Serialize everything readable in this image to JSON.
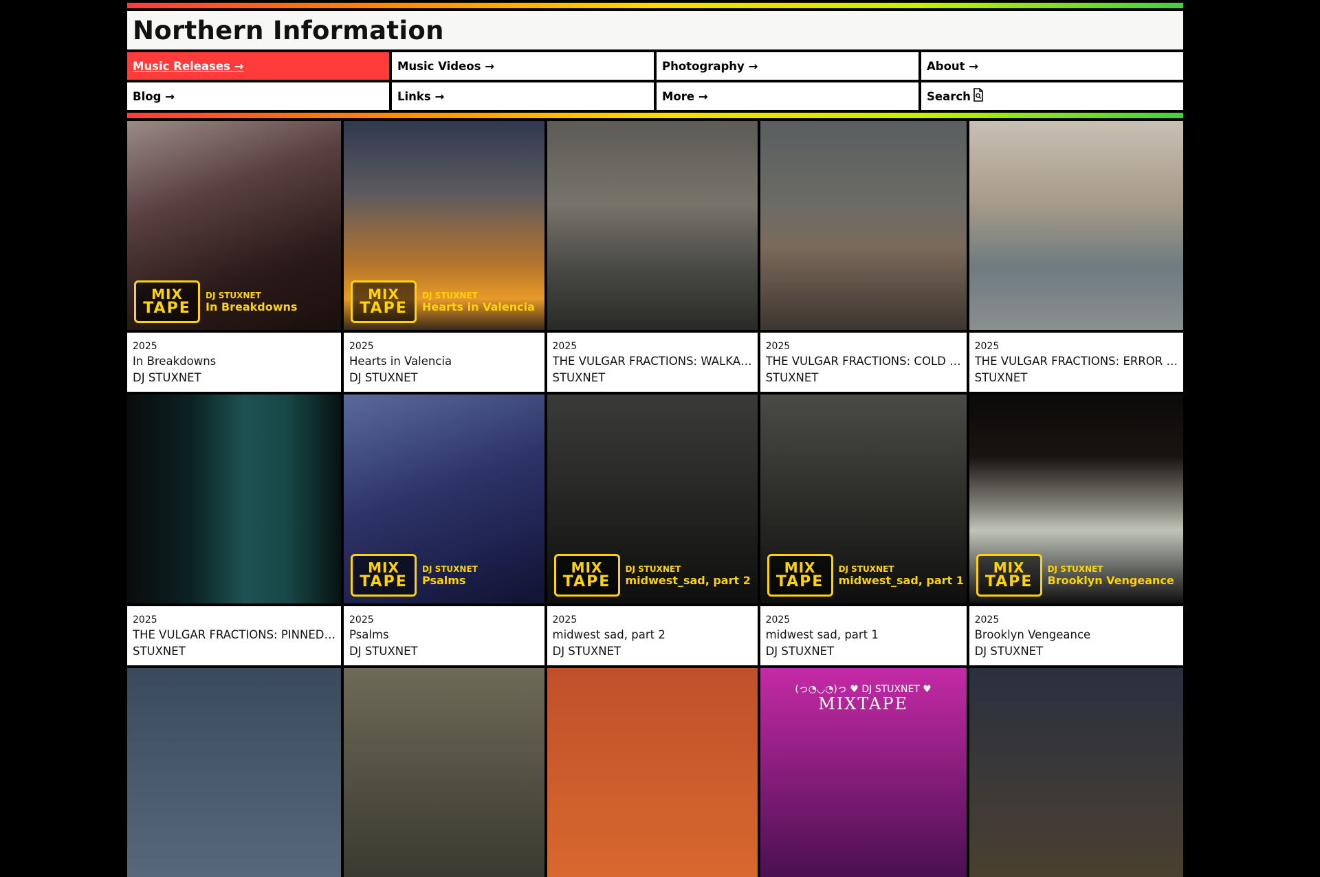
{
  "site": {
    "title": "Northern Information"
  },
  "nav": [
    {
      "label": "Music Releases →",
      "active": true,
      "name": "nav-music-releases"
    },
    {
      "label": "Music Videos →",
      "active": false,
      "name": "nav-music-videos"
    },
    {
      "label": "Photography →",
      "active": false,
      "name": "nav-photography"
    },
    {
      "label": "About →",
      "active": false,
      "name": "nav-about"
    },
    {
      "label": "Blog →",
      "active": false,
      "name": "nav-blog"
    },
    {
      "label": "Links →",
      "active": false,
      "name": "nav-links"
    },
    {
      "label": "More →",
      "active": false,
      "name": "nav-more"
    },
    {
      "label": "Search",
      "active": false,
      "name": "nav-search",
      "icon": "search-document-icon"
    }
  ],
  "badge": {
    "logo_top": "MIX",
    "logo_bottom": "TAPE",
    "dj": "DJ STUXNET"
  },
  "colors": {
    "accent": "#ff3b3b",
    "badge": "#ffd400"
  },
  "releases": [
    {
      "year": "2025",
      "title": "In Breakdowns",
      "artist": "DJ STUXNET",
      "badge_title": "In Breakdowns",
      "bg": "linear-gradient(160deg,#9a8b86 0%,#5a4040 35%,#2a1a18 70%,#1a0f0e 100%)"
    },
    {
      "year": "2025",
      "title": "Hearts in Valencia",
      "artist": "DJ STUXNET",
      "badge_title": "Hearts in Valencia",
      "bg": "linear-gradient(180deg,#2f3950 0%,#5e5a60 35%,#b8762a 70%,#e89a2a 85%,#3a2a18 100%)"
    },
    {
      "year": "2025",
      "title": "THE VULGAR FRACTIONS: WALKA…",
      "artist": "STUXNET",
      "badge_title": "",
      "bg": "linear-gradient(180deg,#5c5b55 0%,#77746a 40%,#4a4a44 70%,#2a2a28 100%)"
    },
    {
      "year": "2025",
      "title": "THE VULGAR FRACTIONS: COLD …",
      "artist": "STUXNET",
      "badge_title": "",
      "bg": "linear-gradient(180deg,#5a5e60 0%,#6c6c66 40%,#7a6a5a 60%,#3e3630 100%)"
    },
    {
      "year": "2025",
      "title": "THE VULGAR FRACTIONS: ERROR …",
      "artist": "STUXNET",
      "badge_title": "",
      "bg": "linear-gradient(180deg,#c8c0b4 0%,#a69a88 40%,#6e7b80 70%,#8a8f90 100%)"
    },
    {
      "year": "2025",
      "title": "THE VULGAR FRACTIONS: PINNED…",
      "artist": "STUXNET",
      "badge_title": "",
      "bg": "linear-gradient(90deg,#0a0c0c 0%,#0b2222 30%,#1e5252 55%,#174747 75%,#071212 100%)"
    },
    {
      "year": "2025",
      "title": "Psalms",
      "artist": "DJ STUXNET",
      "badge_title": "Psalms",
      "bg": "linear-gradient(160deg,#5a6a9a 0%,#2e3468 45%,#1a1e48 80%,#10142e 100%)"
    },
    {
      "year": "2025",
      "title": "midwest sad, part 2",
      "artist": "DJ STUXNET",
      "badge_title": "midwest_sad, part 2",
      "bg": "linear-gradient(180deg,#3a3a38 0%,#2a2a28 40%,#1c1c1a 70%,#0e0e0e 100%)"
    },
    {
      "year": "2025",
      "title": "midwest sad, part 1",
      "artist": "DJ STUXNET",
      "badge_title": "midwest_sad, part 1",
      "bg": "linear-gradient(180deg,#4a4a46 0%,#333330 40%,#1e1e1c 75%,#0e0e0e 100%)"
    },
    {
      "year": "2025",
      "title": "Brooklyn Vengeance",
      "artist": "DJ STUXNET",
      "badge_title": "Brooklyn Vengeance",
      "bg": "linear-gradient(180deg,#0a0a0a 0%,#1a1410 30%,#8a8a80 55%,#c0c4b8 65%,#101010 100%)"
    }
  ],
  "more_tiles": [
    {
      "bg": "linear-gradient(180deg,#3a4a5c 0%,#56687a 100%)"
    },
    {
      "bg": "linear-gradient(180deg,#6e6a58 0%,#3a3a30 100%)"
    },
    {
      "bg": "linear-gradient(180deg,#c0502a 0%,#d8682e 100%)"
    },
    {
      "bg": "linear-gradient(180deg,#c52aa6 0%,#4a1050 100%)",
      "text": "(っ◔◡◔)っ ♥ DJ STUXNET ♥",
      "subtext": "MIXTAPE"
    },
    {
      "bg": "linear-gradient(180deg,#2a3040 0%,#4a4030 100%)"
    }
  ]
}
